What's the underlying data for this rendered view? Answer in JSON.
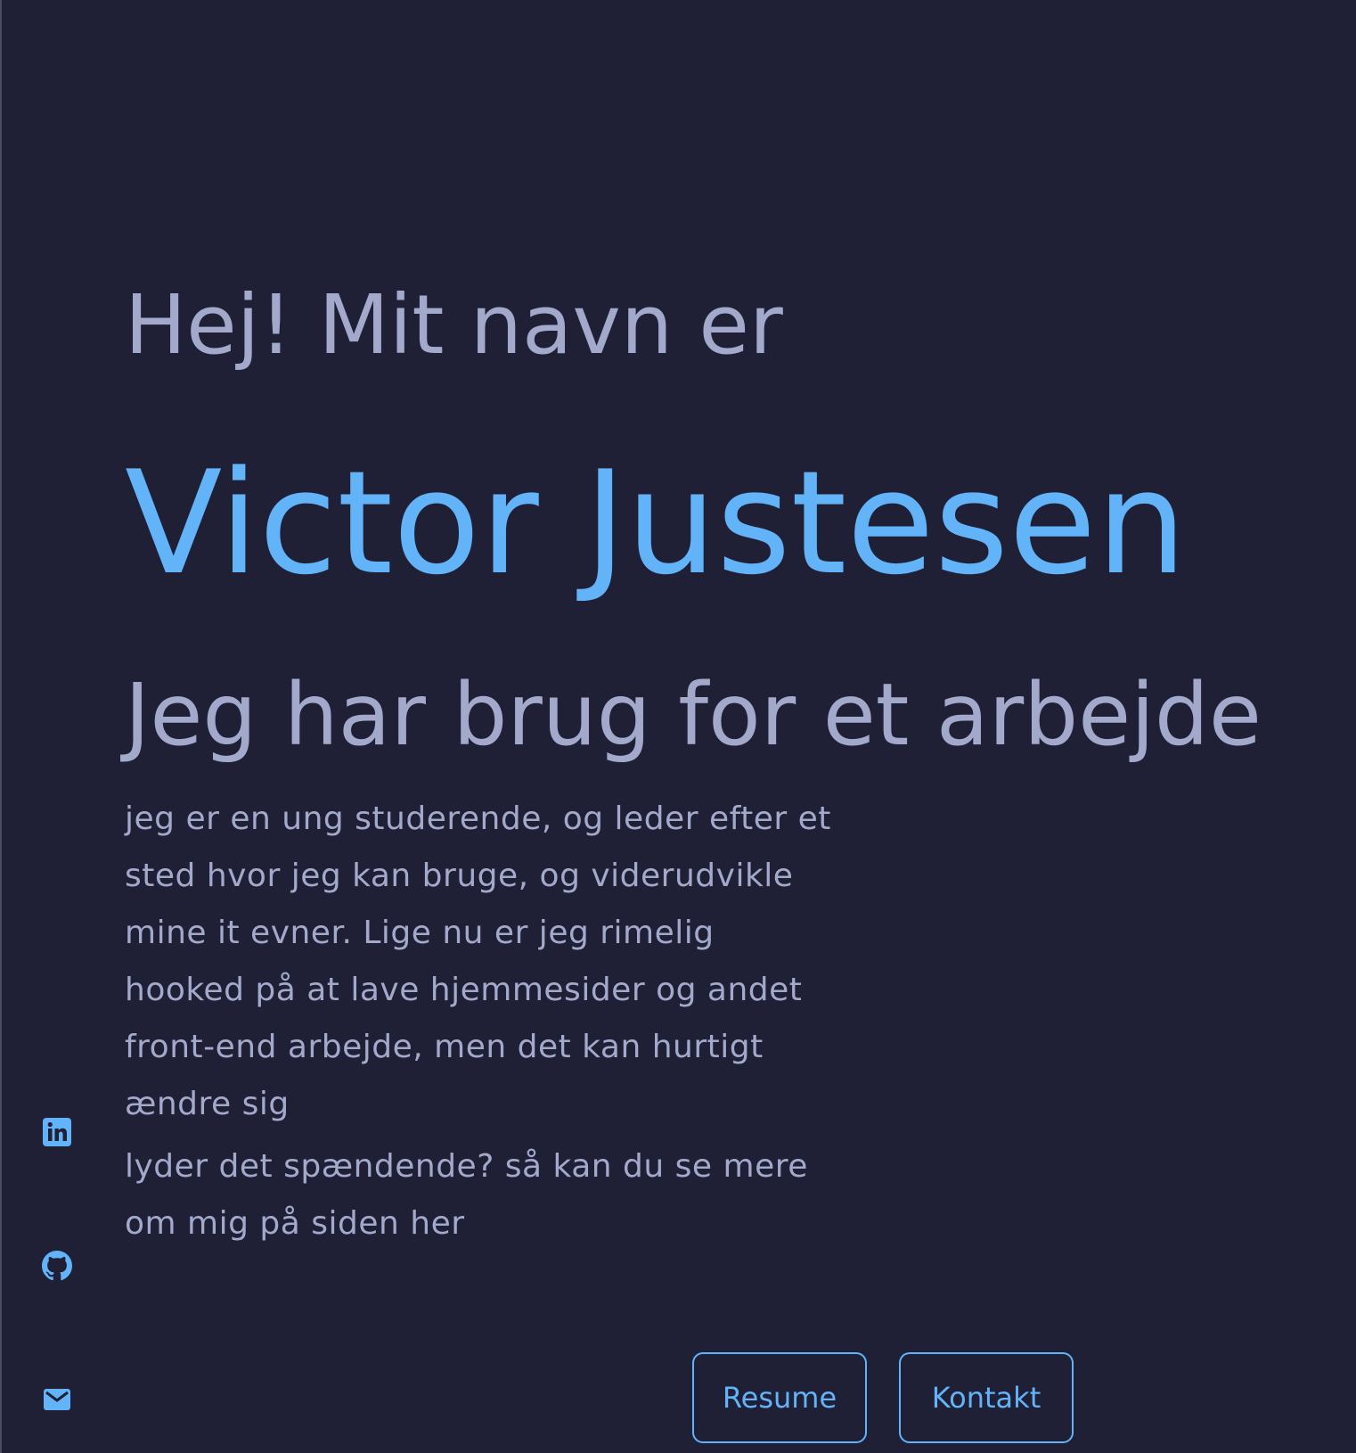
{
  "hero": {
    "greeting": "Hej! Mit navn er",
    "name": "Victor Justesen",
    "tagline": "Jeg har brug for et arbejde"
  },
  "about": {
    "paragraph1_lines": [
      "jeg er en ung studerende, og leder efter et",
      "sted hvor jeg kan bruge, og viderudvikle",
      "mine it evner. Lige nu er jeg rimelig",
      "hooked på at lave hjemmesider og andet",
      "front-end arbejde, men det kan hurtigt",
      "ændre sig"
    ],
    "paragraph2_lines": [
      "lyder det spændende? så kan du se mere",
      "om mig på siden her"
    ]
  },
  "social": {
    "icons": [
      "linkedin-icon",
      "github-icon",
      "mail-icon"
    ]
  },
  "buttons": {
    "resume_label": "Resume",
    "contact_label": "Kontakt"
  },
  "colors": {
    "background": "#1f2036",
    "accent": "#62b3f8",
    "text": "#a3a9cb"
  }
}
